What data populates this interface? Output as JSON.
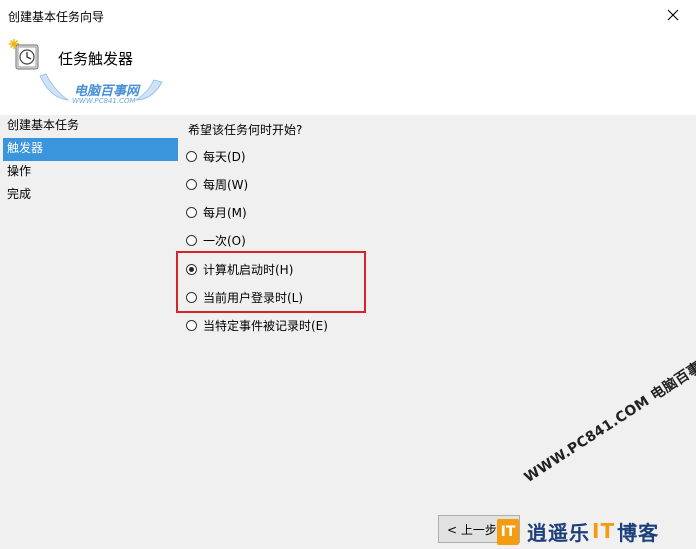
{
  "window": {
    "title": "创建基本任务向导",
    "close_glyph": "✕"
  },
  "header": {
    "title": "任务触发器",
    "icon": "task-clock-icon"
  },
  "watermark_logo": {
    "text": "电脑百事网",
    "subtext": "WWW.PC841.COM"
  },
  "sidebar": {
    "items": [
      {
        "label": "创建基本任务",
        "active": false
      },
      {
        "label": "触发器",
        "active": true
      },
      {
        "label": "操作",
        "active": false
      },
      {
        "label": "完成",
        "active": false
      }
    ]
  },
  "content": {
    "question": "希望该任务何时开始?",
    "options": [
      {
        "label": "每天(D)",
        "checked": false
      },
      {
        "label": "每周(W)",
        "checked": false
      },
      {
        "label": "每月(M)",
        "checked": false
      },
      {
        "label": "一次(O)",
        "checked": false
      },
      {
        "label": "计算机启动时(H)",
        "checked": true
      },
      {
        "label": "当前用户登录时(L)",
        "checked": false
      },
      {
        "label": "当特定事件被记录时(E)",
        "checked": false
      }
    ]
  },
  "diagonal_watermark": "WWW.PC841.COM 电脑百事网",
  "footer": {
    "back_label": "< 上一步("
  },
  "brand_banner": {
    "badge": "IT",
    "text_a": "逍遥乐",
    "text_it": "IT",
    "text_b": "博客"
  },
  "colors": {
    "selection": "#3a95dc",
    "highlight_border": "#d9222a",
    "brand_blue": "#1d3f7a",
    "brand_orange": "#f39c12"
  }
}
